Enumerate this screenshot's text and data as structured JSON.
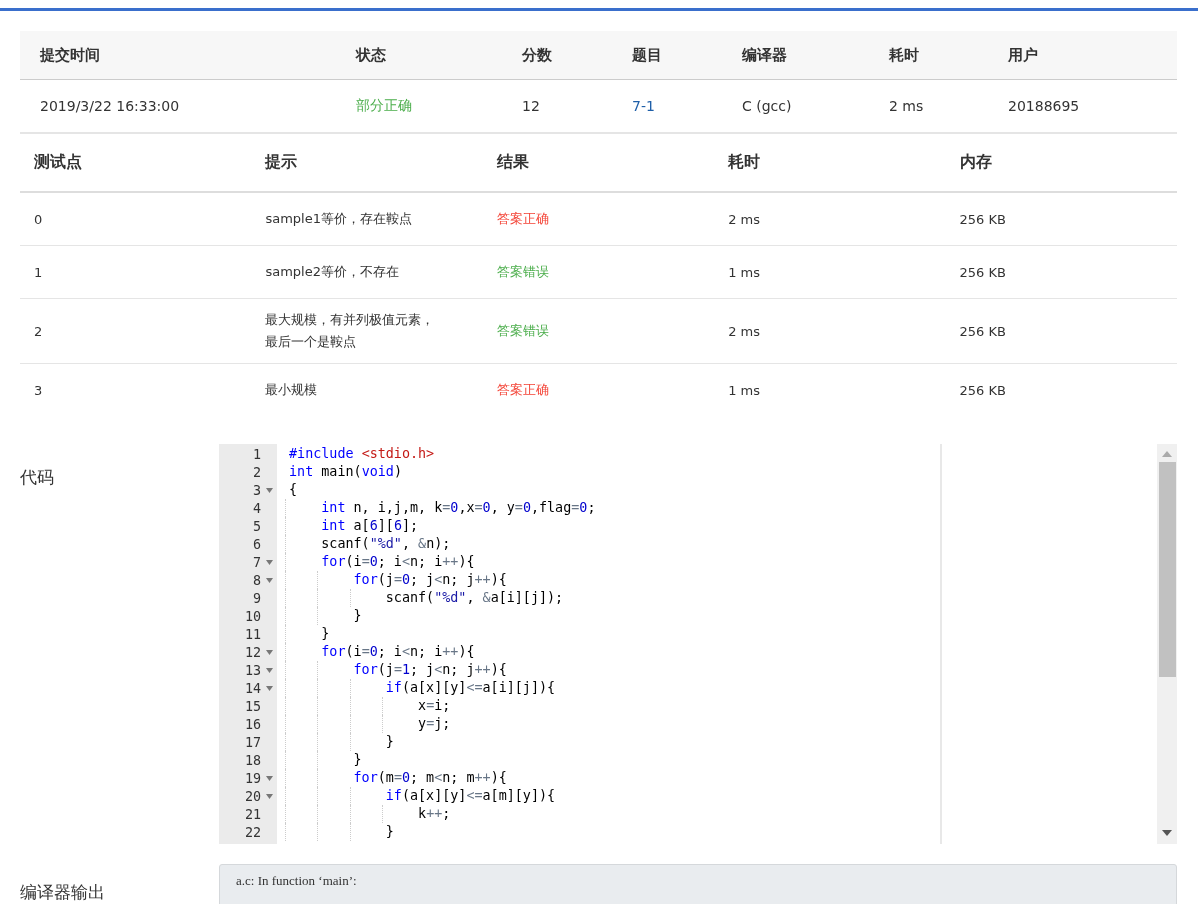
{
  "submission": {
    "columns": [
      "提交时间",
      "状态",
      "分数",
      "题目",
      "编译器",
      "耗时",
      "用户"
    ],
    "row": {
      "time": "2019/3/22 16:33:00",
      "status": "部分正确",
      "color": "#4cae4c",
      "score": "12",
      "problem": "7-1",
      "compiler": "C (gcc)",
      "duration": "2 ms",
      "user": "20188695"
    }
  },
  "tests": {
    "columns": [
      "测试点",
      "提示",
      "结果",
      "耗时",
      "内存"
    ],
    "rows": [
      {
        "id": "0",
        "hint": "sample1等价，存在鞍点",
        "result": "答案正确",
        "color": "#f44336",
        "time": "2 ms",
        "memory": "256 KB"
      },
      {
        "id": "1",
        "hint": "sample2等价，不存在",
        "result": "答案错误",
        "color": "#4cae4c",
        "time": "1 ms",
        "memory": "256 KB"
      },
      {
        "id": "2",
        "hint": "最大规模，有并列极值元素，最后一个是鞍点",
        "result": "答案错误",
        "color": "#4cae4c",
        "time": "2 ms",
        "memory": "256 KB"
      },
      {
        "id": "3",
        "hint": "最小规模",
        "result": "答案正确",
        "color": "#f44336",
        "time": "1 ms",
        "memory": "256 KB"
      }
    ]
  },
  "code": {
    "label": "代码",
    "lines": [
      {
        "number": "1",
        "foldable": false,
        "tokens": [
          {
            "kind": "kw",
            "text": "#include "
          },
          {
            "kind": "inc",
            "text": "<stdio.h>"
          }
        ]
      },
      {
        "number": "2",
        "foldable": false,
        "tokens": [
          {
            "kind": "kw",
            "text": "int"
          },
          {
            "kind": "plain",
            "text": " main("
          },
          {
            "kind": "kw",
            "text": "void"
          },
          {
            "kind": "plain",
            "text": ")"
          }
        ]
      },
      {
        "number": "3",
        "foldable": true,
        "tokens": [
          {
            "kind": "plain",
            "text": "{"
          }
        ]
      },
      {
        "number": "4",
        "foldable": false,
        "tokens": [
          {
            "kind": "kw",
            "text": "    int"
          },
          {
            "kind": "plain",
            "text": " n, i,j,m, k"
          },
          {
            "kind": "op",
            "text": "="
          },
          {
            "kind": "num",
            "text": "0"
          },
          {
            "kind": "plain",
            "text": ",x"
          },
          {
            "kind": "op",
            "text": "="
          },
          {
            "kind": "num",
            "text": "0"
          },
          {
            "kind": "plain",
            "text": ", y"
          },
          {
            "kind": "op",
            "text": "="
          },
          {
            "kind": "num",
            "text": "0"
          },
          {
            "kind": "plain",
            "text": ",flag"
          },
          {
            "kind": "op",
            "text": "="
          },
          {
            "kind": "num",
            "text": "0"
          },
          {
            "kind": "plain",
            "text": ";"
          }
        ]
      },
      {
        "number": "5",
        "foldable": false,
        "tokens": [
          {
            "kind": "kw",
            "text": "    int"
          },
          {
            "kind": "plain",
            "text": " a["
          },
          {
            "kind": "num",
            "text": "6"
          },
          {
            "kind": "plain",
            "text": "]["
          },
          {
            "kind": "num",
            "text": "6"
          },
          {
            "kind": "plain",
            "text": "];"
          }
        ]
      },
      {
        "number": "6",
        "foldable": false,
        "tokens": [
          {
            "kind": "plain",
            "text": "    scanf("
          },
          {
            "kind": "str",
            "text": "\"%d\""
          },
          {
            "kind": "plain",
            "text": ", "
          },
          {
            "kind": "op",
            "text": "&"
          },
          {
            "kind": "plain",
            "text": "n);"
          }
        ]
      },
      {
        "number": "7",
        "foldable": true,
        "tokens": [
          {
            "kind": "kw",
            "text": "    for"
          },
          {
            "kind": "plain",
            "text": "(i"
          },
          {
            "kind": "op",
            "text": "="
          },
          {
            "kind": "num",
            "text": "0"
          },
          {
            "kind": "plain",
            "text": "; i"
          },
          {
            "kind": "op",
            "text": "<"
          },
          {
            "kind": "plain",
            "text": "n; i"
          },
          {
            "kind": "op",
            "text": "++"
          },
          {
            "kind": "plain",
            "text": "){"
          }
        ]
      },
      {
        "number": "8",
        "foldable": true,
        "tokens": [
          {
            "kind": "kw",
            "text": "        for"
          },
          {
            "kind": "plain",
            "text": "(j"
          },
          {
            "kind": "op",
            "text": "="
          },
          {
            "kind": "num",
            "text": "0"
          },
          {
            "kind": "plain",
            "text": "; j"
          },
          {
            "kind": "op",
            "text": "<"
          },
          {
            "kind": "plain",
            "text": "n; j"
          },
          {
            "kind": "op",
            "text": "++"
          },
          {
            "kind": "plain",
            "text": "){"
          }
        ]
      },
      {
        "number": "9",
        "foldable": false,
        "tokens": [
          {
            "kind": "plain",
            "text": "            scanf("
          },
          {
            "kind": "str",
            "text": "\"%d\""
          },
          {
            "kind": "plain",
            "text": ", "
          },
          {
            "kind": "op",
            "text": "&"
          },
          {
            "kind": "plain",
            "text": "a[i][j]);"
          }
        ]
      },
      {
        "number": "10",
        "foldable": false,
        "tokens": [
          {
            "kind": "plain",
            "text": "        }"
          }
        ]
      },
      {
        "number": "11",
        "foldable": false,
        "tokens": [
          {
            "kind": "plain",
            "text": "    }"
          }
        ]
      },
      {
        "number": "12",
        "foldable": true,
        "tokens": [
          {
            "kind": "kw",
            "text": "    for"
          },
          {
            "kind": "plain",
            "text": "(i"
          },
          {
            "kind": "op",
            "text": "="
          },
          {
            "kind": "num",
            "text": "0"
          },
          {
            "kind": "plain",
            "text": "; i"
          },
          {
            "kind": "op",
            "text": "<"
          },
          {
            "kind": "plain",
            "text": "n; i"
          },
          {
            "kind": "op",
            "text": "++"
          },
          {
            "kind": "plain",
            "text": "){"
          }
        ]
      },
      {
        "number": "13",
        "foldable": true,
        "tokens": [
          {
            "kind": "kw",
            "text": "        for"
          },
          {
            "kind": "plain",
            "text": "(j"
          },
          {
            "kind": "op",
            "text": "="
          },
          {
            "kind": "num",
            "text": "1"
          },
          {
            "kind": "plain",
            "text": "; j"
          },
          {
            "kind": "op",
            "text": "<"
          },
          {
            "kind": "plain",
            "text": "n; j"
          },
          {
            "kind": "op",
            "text": "++"
          },
          {
            "kind": "plain",
            "text": "){"
          }
        ]
      },
      {
        "number": "14",
        "foldable": true,
        "tokens": [
          {
            "kind": "kw",
            "text": "            if"
          },
          {
            "kind": "plain",
            "text": "(a[x][y]"
          },
          {
            "kind": "op",
            "text": "<="
          },
          {
            "kind": "plain",
            "text": "a[i][j]){"
          }
        ]
      },
      {
        "number": "15",
        "foldable": false,
        "tokens": [
          {
            "kind": "plain",
            "text": "                x"
          },
          {
            "kind": "op",
            "text": "="
          },
          {
            "kind": "plain",
            "text": "i;"
          }
        ]
      },
      {
        "number": "16",
        "foldable": false,
        "tokens": [
          {
            "kind": "plain",
            "text": "                y"
          },
          {
            "kind": "op",
            "text": "="
          },
          {
            "kind": "plain",
            "text": "j;"
          }
        ]
      },
      {
        "number": "17",
        "foldable": false,
        "tokens": [
          {
            "kind": "plain",
            "text": "            }"
          }
        ]
      },
      {
        "number": "18",
        "foldable": false,
        "tokens": [
          {
            "kind": "plain",
            "text": "        }"
          }
        ]
      },
      {
        "number": "19",
        "foldable": true,
        "tokens": [
          {
            "kind": "kw",
            "text": "        for"
          },
          {
            "kind": "plain",
            "text": "(m"
          },
          {
            "kind": "op",
            "text": "="
          },
          {
            "kind": "num",
            "text": "0"
          },
          {
            "kind": "plain",
            "text": "; m"
          },
          {
            "kind": "op",
            "text": "<"
          },
          {
            "kind": "plain",
            "text": "n; m"
          },
          {
            "kind": "op",
            "text": "++"
          },
          {
            "kind": "plain",
            "text": "){"
          }
        ]
      },
      {
        "number": "20",
        "foldable": true,
        "tokens": [
          {
            "kind": "kw",
            "text": "            if"
          },
          {
            "kind": "plain",
            "text": "(a[x][y]"
          },
          {
            "kind": "op",
            "text": "<="
          },
          {
            "kind": "plain",
            "text": "a[m][y]){"
          }
        ]
      },
      {
        "number": "21",
        "foldable": false,
        "tokens": [
          {
            "kind": "plain",
            "text": "                k"
          },
          {
            "kind": "op",
            "text": "++"
          },
          {
            "kind": "plain",
            "text": ";"
          }
        ]
      },
      {
        "number": "22",
        "foldable": false,
        "tokens": [
          {
            "kind": "plain",
            "text": "            }"
          }
        ]
      }
    ]
  },
  "compiler_output": {
    "label": "编译器输出",
    "lines": [
      "a.c: In function ‘main’:"
    ]
  }
}
